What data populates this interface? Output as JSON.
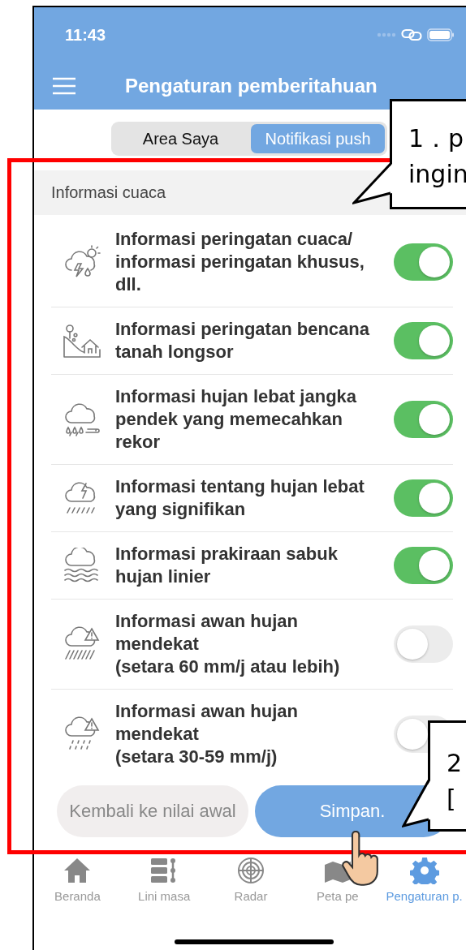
{
  "status_bar": {
    "time": "11:43"
  },
  "header": {
    "title": "Pengaturan pemberitahuan"
  },
  "segments": [
    {
      "label": "Area Saya",
      "selected": false
    },
    {
      "label": "Notifikasi push",
      "selected": true
    }
  ],
  "section": {
    "title": "Informasi cuaca"
  },
  "items": [
    {
      "kind": "storm",
      "label": "Informasi peringatan cuaca/ informasi peringatan khusus, dll.",
      "on": true
    },
    {
      "kind": "landslide",
      "label": "Informasi peringatan bencana tanah longsor",
      "on": true
    },
    {
      "kind": "record-rain",
      "label": "Informasi hujan lebat jangka pendek yang memecahkan rekor",
      "on": true
    },
    {
      "kind": "thunder-rain",
      "label": "Informasi tentang hujan lebat yang signifikan",
      "on": true
    },
    {
      "kind": "band-rain",
      "label": "Informasi prakiraan sabuk hujan linier",
      "on": true
    },
    {
      "kind": "warn-heavy",
      "label": "Informasi awan hujan mendekat\n(setara 60 mm/j atau lebih)",
      "on": false
    },
    {
      "kind": "warn-light",
      "label": "Informasi awan hujan mendekat\n(setara 30-59 mm/j)",
      "on": false
    }
  ],
  "buttons": {
    "reset": "Kembali ke nilai awal",
    "save": "Simpan."
  },
  "tab_bar": [
    {
      "kind": "home",
      "label": "Beranda",
      "selected": false
    },
    {
      "kind": "timeline",
      "label": "Lini masa",
      "selected": false
    },
    {
      "kind": "radar",
      "label": "Radar",
      "selected": false
    },
    {
      "kind": "map",
      "label": "Peta pe",
      "selected": false
    },
    {
      "kind": "gear",
      "label": "Pengaturan p.",
      "selected": true
    }
  ],
  "callouts": [
    {
      "text": "1．p\ningin"
    },
    {
      "text": "2\n["
    }
  ]
}
